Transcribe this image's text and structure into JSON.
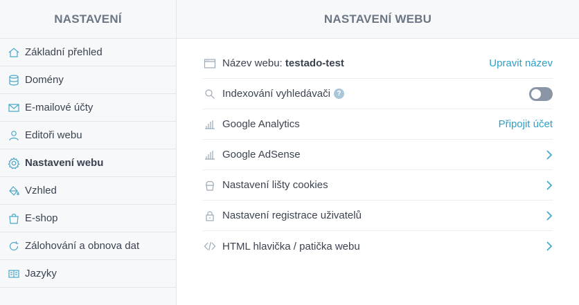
{
  "sidebar": {
    "title": "NASTAVENÍ",
    "items": [
      {
        "label": "Základní přehled",
        "icon": "home-icon"
      },
      {
        "label": "Domény",
        "icon": "database-icon"
      },
      {
        "label": "E-mailové účty",
        "icon": "envelope-icon"
      },
      {
        "label": "Editoři webu",
        "icon": "user-icon"
      },
      {
        "label": "Nastavení webu",
        "icon": "gear-icon",
        "active": true
      },
      {
        "label": "Vzhled",
        "icon": "paint-bucket-icon"
      },
      {
        "label": "E-shop",
        "icon": "shopping-bag-icon"
      },
      {
        "label": "Zálohování a obnova dat",
        "icon": "refresh-icon"
      },
      {
        "label": "Jazyky",
        "icon": "language-icon"
      }
    ]
  },
  "main": {
    "title": "NASTAVENÍ WEBU",
    "rows": [
      {
        "label": "Název webu:",
        "value": "testado-test",
        "action": "Upravit název",
        "icon": "browser-window-icon"
      },
      {
        "label": "Indexování vyhledávači",
        "help": "?",
        "toggle_state": "off",
        "icon": "search-icon"
      },
      {
        "label": "Google Analytics",
        "action": "Připojit účet",
        "icon": "bar-chart-icon"
      },
      {
        "label": "Google AdSense",
        "icon": "bar-chart-icon"
      },
      {
        "label": "Nastavení lišty cookies",
        "icon": "cookie-icon"
      },
      {
        "label": "Nastavení registrace uživatelů",
        "icon": "lock-icon"
      },
      {
        "label": "HTML hlavička / patička webu",
        "icon": "code-icon"
      }
    ]
  },
  "colors": {
    "accent": "#2f9fc6",
    "toggle_off": "#8a96a6",
    "sidebar_bg": "#f7f8f9",
    "header_text": "#6b7583"
  }
}
